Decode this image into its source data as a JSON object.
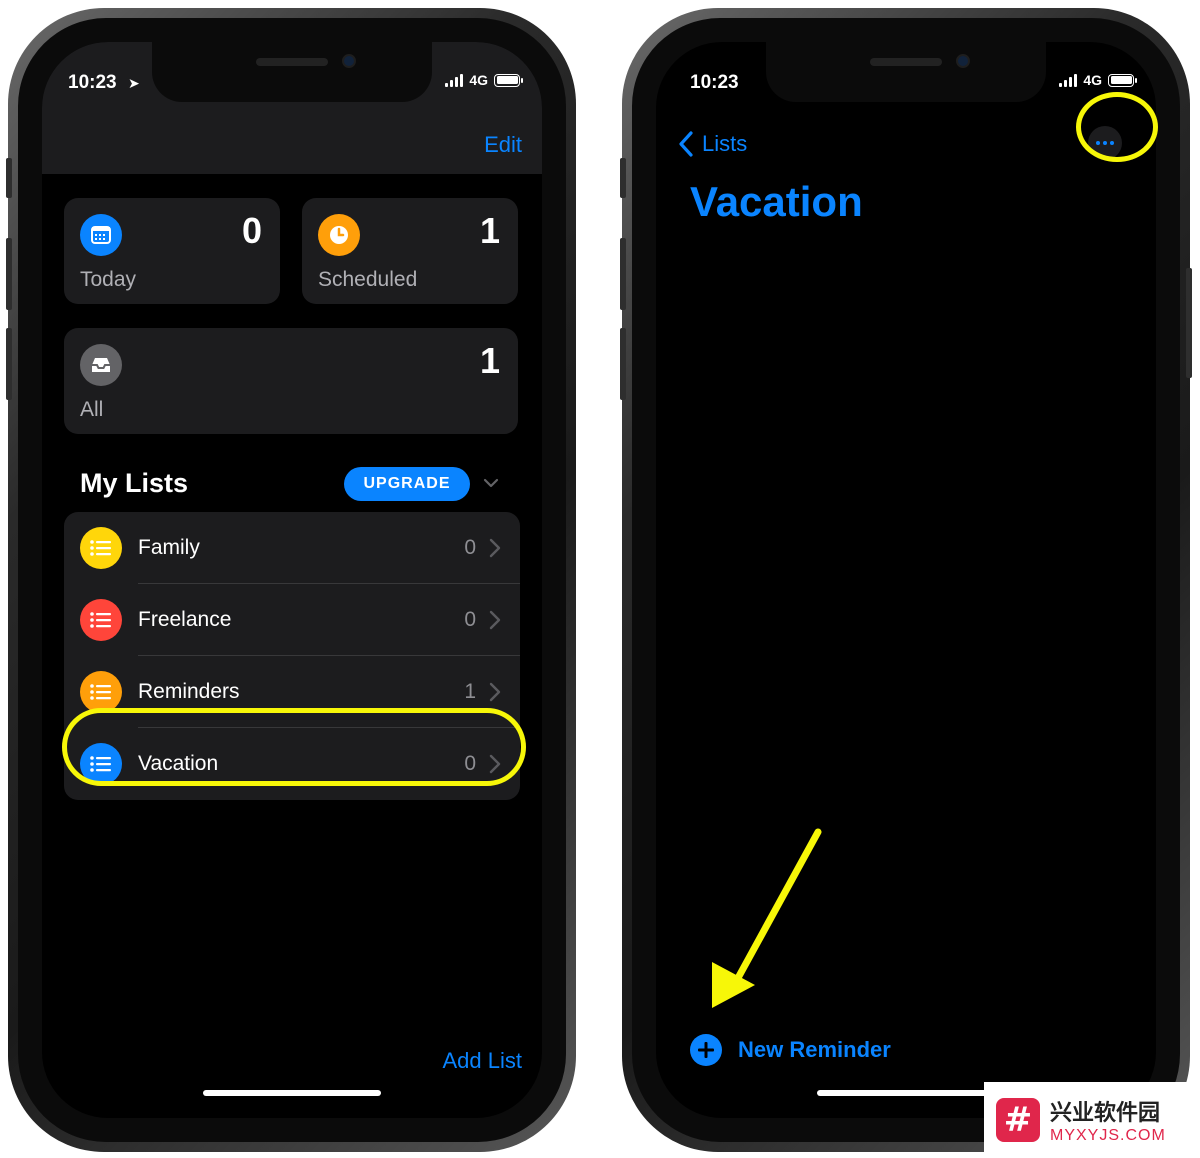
{
  "left_screen": {
    "status": {
      "time": "10:23",
      "network": "4G"
    },
    "edit_label": "Edit",
    "smart_lists": {
      "today": {
        "label": "Today",
        "count": "0",
        "color": "#0a84ff"
      },
      "scheduled": {
        "label": "Scheduled",
        "count": "1",
        "color": "#ff9f0a"
      },
      "all": {
        "label": "All",
        "count": "1",
        "color": "#636366"
      }
    },
    "section_title": "My Lists",
    "upgrade_label": "UPGRADE",
    "lists": [
      {
        "label": "Family",
        "count": "0",
        "color": "#ffd60a"
      },
      {
        "label": "Freelance",
        "count": "0",
        "color": "#ff453a"
      },
      {
        "label": "Reminders",
        "count": "1",
        "color": "#ff9f0a"
      },
      {
        "label": "Vacation",
        "count": "0",
        "color": "#0a84ff"
      }
    ],
    "add_list_label": "Add List"
  },
  "right_screen": {
    "status": {
      "time": "10:23",
      "network": "4G"
    },
    "back_label": "Lists",
    "title": "Vacation",
    "new_reminder_label": "New Reminder"
  },
  "annotations": {
    "highlight_color": "#f7f708"
  },
  "watermark": {
    "logo_char": "#",
    "cn": "兴业软件园",
    "en": "MYXYJS.COM"
  }
}
